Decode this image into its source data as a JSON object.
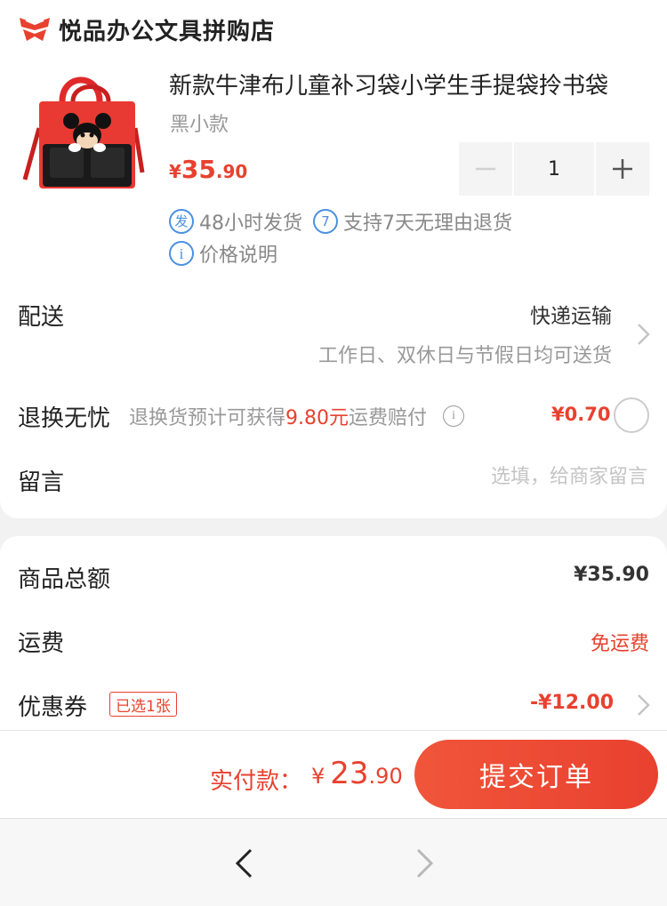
{
  "store": {
    "name": "悦品办公文具拼购店",
    "logo_icon": "store-bow-logo-icon"
  },
  "product": {
    "title": "新款牛津布儿童补习袋小学生手提袋拎书袋",
    "variant": "黑小款",
    "price_symbol": "¥",
    "price_int": "35",
    "price_dec": ".90",
    "quantity": "1",
    "tags": [
      {
        "icon": "发",
        "text": "48小时发货"
      },
      {
        "icon": "7",
        "text": "支持7天无理由退货"
      },
      {
        "icon": "i",
        "text": "价格说明"
      }
    ]
  },
  "delivery": {
    "label": "配送",
    "value": "快递运输",
    "sub": "工作日、双休日与节假日均可送货"
  },
  "returns": {
    "label": "退换无忧",
    "desc_prefix": "退换货预计可获得",
    "desc_amount": "9.80元",
    "desc_suffix": "运费赔付",
    "price": "¥0.70"
  },
  "message": {
    "label": "留言",
    "placeholder": "选填，给商家留言"
  },
  "summary": {
    "total_label": "商品总额",
    "total_value": "¥35.90",
    "shipping_label": "运费",
    "shipping_value": "免运费",
    "coupon_label": "优惠券",
    "coupon_badge": "已选1张",
    "coupon_value": "-¥12.00"
  },
  "checkout": {
    "pay_label": "实付款：",
    "pay_symbol": "¥",
    "pay_int": "23",
    "pay_dec": ".90",
    "submit_label": "提交订单"
  },
  "colors": {
    "accent": "#e8412f",
    "link_blue": "#4a90e2",
    "muted": "#999999"
  }
}
